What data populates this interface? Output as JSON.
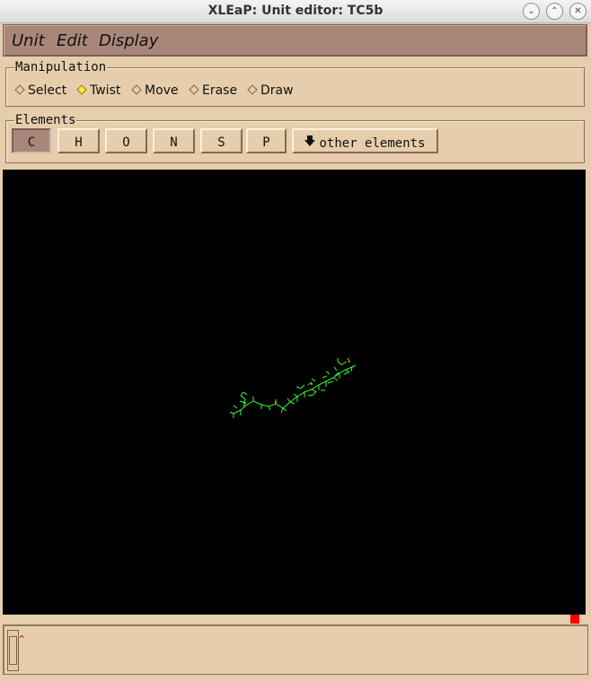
{
  "window": {
    "title": "XLEaP: Unit editor: TC5b",
    "controls": [
      "⌄",
      "⌃",
      "✕"
    ]
  },
  "menubar": {
    "items": [
      "Unit",
      "Edit",
      "Display"
    ]
  },
  "manipulation": {
    "label": "Manipulation",
    "options": [
      "Select",
      "Twist",
      "Move",
      "Erase",
      "Draw"
    ],
    "selected": "Twist"
  },
  "elements": {
    "label": "Elements",
    "buttons": [
      "C",
      "H",
      "O",
      "N",
      "S",
      "P"
    ],
    "active": "C",
    "other_label": "other elements"
  },
  "viewport": {
    "background": "#000000",
    "bond_color": "#33ff33"
  },
  "console": {
    "caret": "^"
  }
}
